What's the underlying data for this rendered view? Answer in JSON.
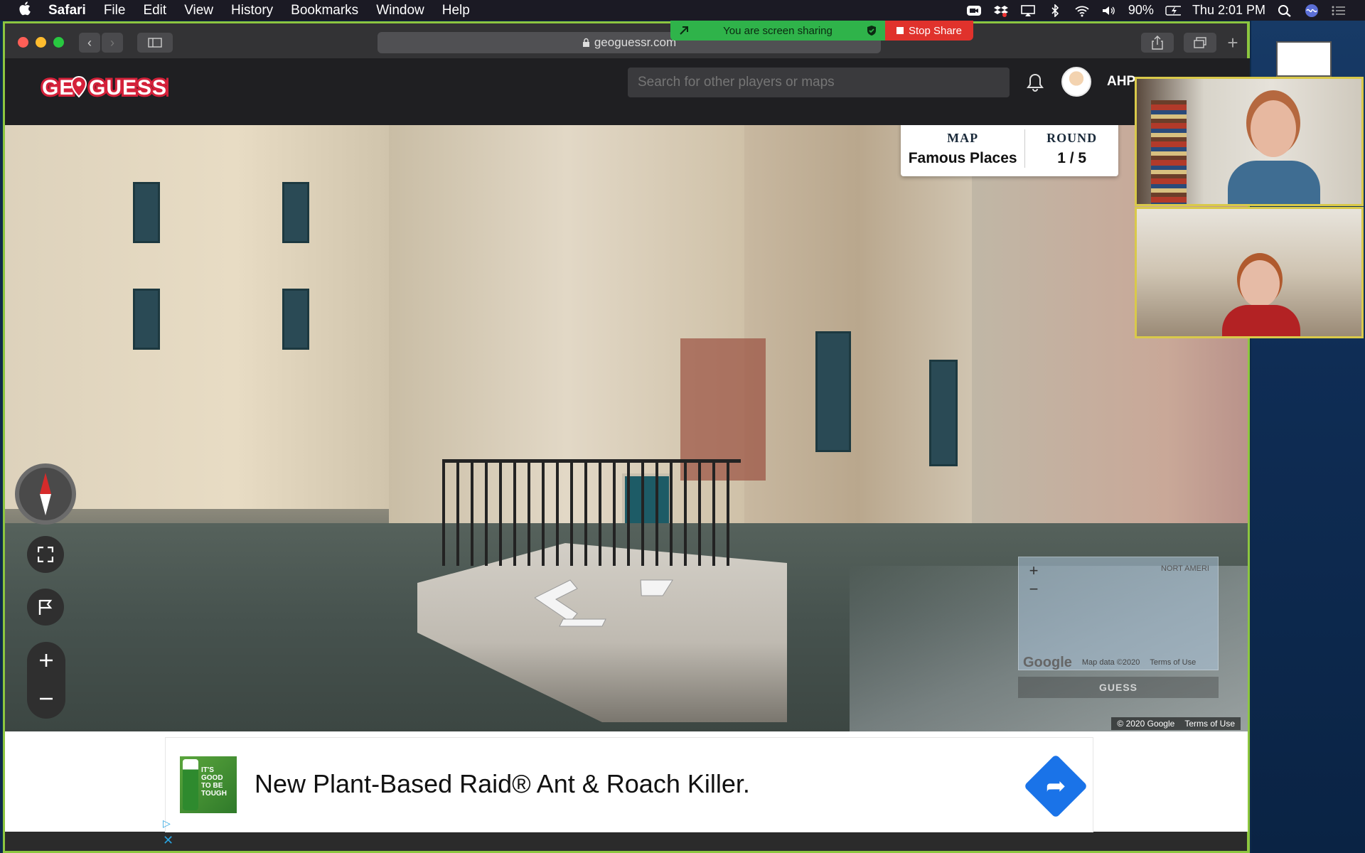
{
  "menubar": {
    "app_name": "Safari",
    "items": [
      "File",
      "Edit",
      "View",
      "History",
      "Bookmarks",
      "Window",
      "Help"
    ],
    "battery": "90%",
    "clock": "Thu 2:01 PM"
  },
  "screen_share": {
    "status": "You are screen sharing",
    "stop_label": "Stop Share"
  },
  "browser": {
    "url": "geoguessr.com"
  },
  "geoguessr": {
    "search_placeholder": "Search for other players or maps",
    "username": "AHP",
    "map_label": "MAP",
    "map_value": "Famous Places",
    "round_label": "ROUND",
    "round_value": "1 / 5",
    "minimap_region": "NORT AMERI",
    "minimap_google": "Google",
    "minimap_data": "Map data ©2020",
    "minimap_terms": "Terms of Use",
    "guess_label": "GUESS",
    "copyright": "© 2020 Google",
    "terms": "Terms of Use"
  },
  "ad": {
    "headline": "New Plant-Based Raid® Ant & Roach Killer.",
    "image_text": "IT'S GOOD TO BE TOUGH"
  },
  "colors": {
    "share_green": "#2fb34a",
    "share_red": "#e0322c",
    "brand_red": "#d4213a",
    "ad_blue": "#1a73e8"
  }
}
